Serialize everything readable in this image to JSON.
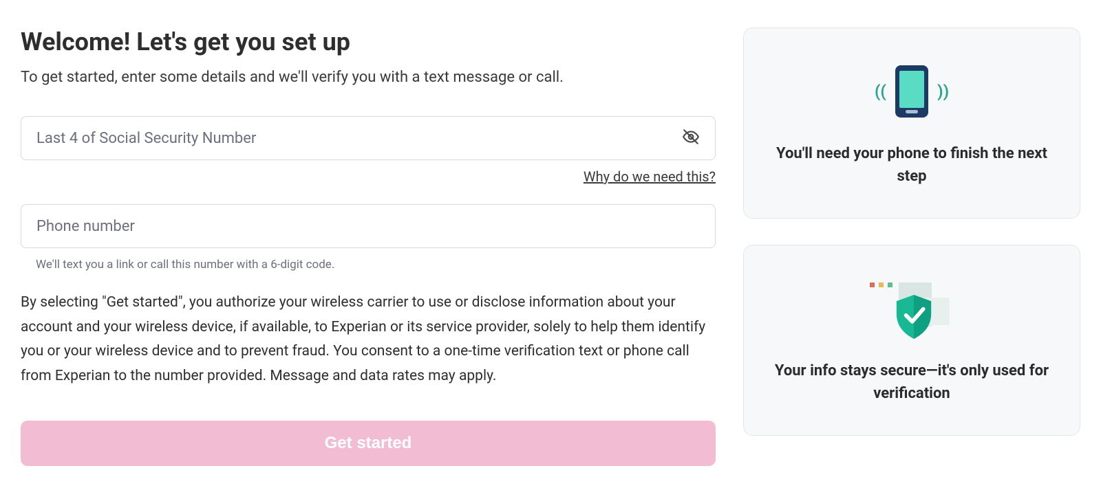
{
  "header": {
    "title": "Welcome! Let's get you set up",
    "subtitle": "To get started, enter some details and we'll verify you with a text message or call."
  },
  "form": {
    "ssn": {
      "placeholder": "Last 4 of Social Security Number",
      "value": "",
      "why_link": "Why do we need this?"
    },
    "phone": {
      "placeholder": "Phone number",
      "value": "",
      "help_text": "We'll text you a link or call this number with a 6-digit code."
    },
    "consent_text": "By selecting \"Get started\", you authorize your wireless carrier to use or disclose information about your account and your wireless device, if available, to Experian or its service provider, solely to help them identify you or your wireless device and to prevent fraud. You consent to a one-time verification text or phone call from Experian to the number provided. Message and data rates may apply.",
    "submit_label": "Get started"
  },
  "side_cards": {
    "phone_card": {
      "text": "You'll need your phone to finish the next step"
    },
    "secure_card": {
      "text": "Your info stays secure—it's only used for verification"
    }
  }
}
